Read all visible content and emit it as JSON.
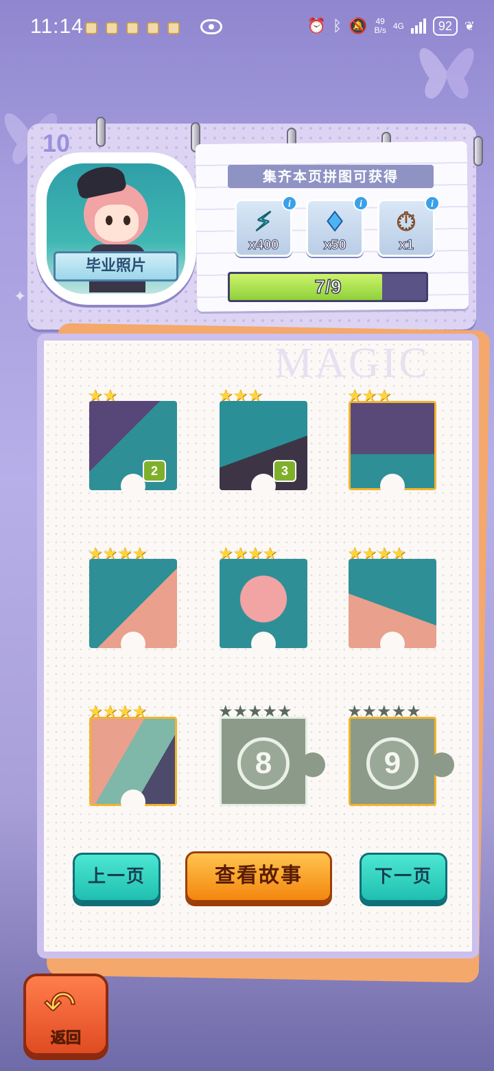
{
  "status_bar": {
    "time": "11:14",
    "net_speed_value": "49",
    "net_speed_unit": "B/s",
    "network": "4G",
    "battery": "92"
  },
  "header": {
    "page_number": "10",
    "badge_title": "毕业照片",
    "reward_title": "集齐本页拼图可获得",
    "rewards": [
      {
        "icon": "lightning-energy-icon",
        "qty": "x400"
      },
      {
        "icon": "diamond-gem-icon",
        "qty": "x50"
      },
      {
        "icon": "stopwatch-icon",
        "qty": "x1"
      }
    ],
    "progress": {
      "current": 7,
      "total": 9,
      "label": "7/9"
    }
  },
  "board": {
    "watermark": "MAGIC",
    "pieces": [
      {
        "stars": 2,
        "max_stars": 2,
        "count": "2",
        "locked": false
      },
      {
        "stars": 3,
        "max_stars": 3,
        "count": "3",
        "locked": false
      },
      {
        "stars": 3,
        "max_stars": 3,
        "count": "",
        "locked": false
      },
      {
        "stars": 4,
        "max_stars": 4,
        "count": "",
        "locked": false
      },
      {
        "stars": 4,
        "max_stars": 4,
        "count": "",
        "locked": false
      },
      {
        "stars": 4,
        "max_stars": 4,
        "count": "",
        "locked": false
      },
      {
        "stars": 4,
        "max_stars": 4,
        "count": "",
        "locked": false
      },
      {
        "stars": 0,
        "max_stars": 5,
        "number": "8",
        "locked": true
      },
      {
        "stars": 0,
        "max_stars": 5,
        "number": "9",
        "locked": true
      }
    ]
  },
  "buttons": {
    "prev": "上一页",
    "story": "查看故事",
    "next": "下一页",
    "back": "返回"
  },
  "colors": {
    "accent_teal": "#1fbfb0",
    "accent_orange": "#f3860e",
    "progress_green": "#8fd13a",
    "star_gold": "#ffd43a"
  }
}
